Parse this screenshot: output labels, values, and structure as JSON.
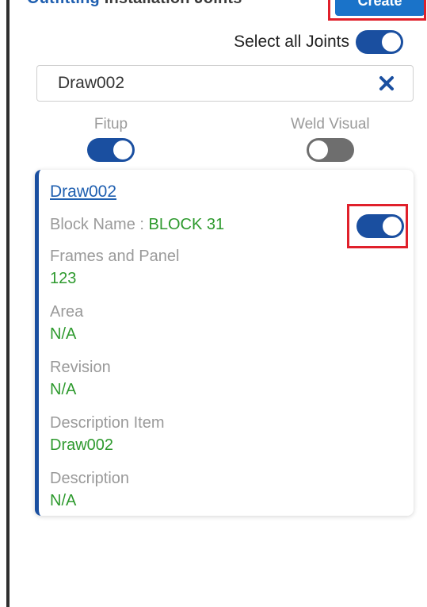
{
  "header": {
    "title_primary": "Outfitting",
    "title_secondary": "Installation Joints",
    "create_label": "Create"
  },
  "select_all": {
    "label": "Select all Joints",
    "enabled": true
  },
  "search": {
    "value": "Draw002",
    "placeholder": ""
  },
  "filters": {
    "fitup": {
      "label": "Fitup",
      "enabled": true
    },
    "weld_visual": {
      "label": "Weld Visual",
      "enabled": false
    }
  },
  "card": {
    "title": "Draw002",
    "block_label": "Block Name : ",
    "block_value": "BLOCK 31",
    "selected": true,
    "fields": [
      {
        "label": "Frames and Panel",
        "value": "123"
      },
      {
        "label": "Area",
        "value": "N/A"
      },
      {
        "label": "Revision",
        "value": "N/A"
      },
      {
        "label": "Description Item",
        "value": "Draw002"
      },
      {
        "label": "Description",
        "value": "N/A"
      }
    ]
  },
  "colors": {
    "primary": "#1a4fa0",
    "link": "#1f5fb0",
    "value_green": "#2e9a2e",
    "highlight_red": "#e0202b",
    "muted": "#9a9a9a"
  }
}
